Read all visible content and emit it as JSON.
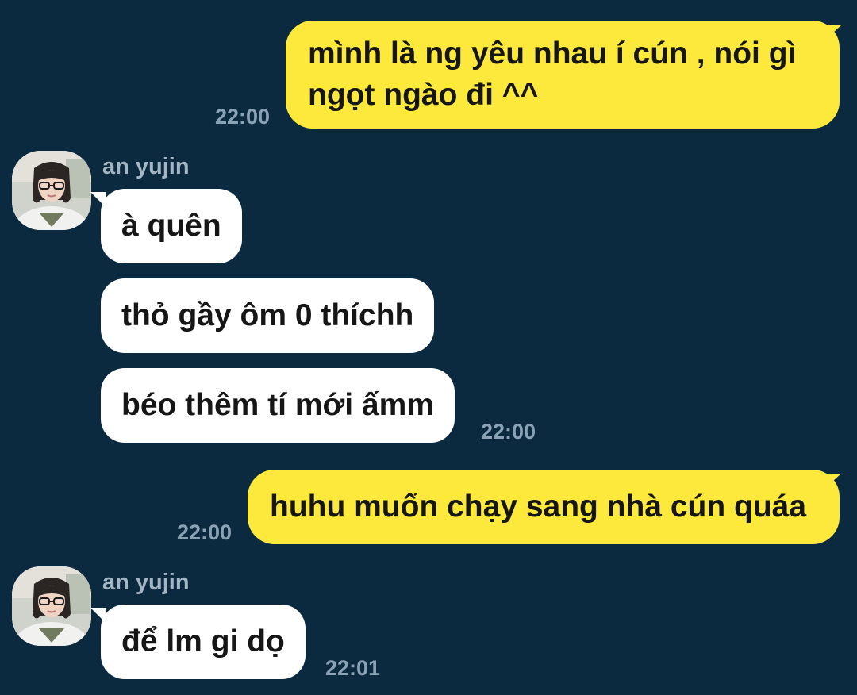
{
  "chat": {
    "messages": [
      {
        "side": "out",
        "text": "mình là ng yêu nhau í cún , nói gì ngọt ngào đi ^^",
        "time": "22:00"
      },
      {
        "side": "in",
        "sender": "an yujin",
        "text": "à quên"
      },
      {
        "side": "in",
        "text": "thỏ gầy ôm 0 thíchh"
      },
      {
        "side": "in",
        "text": "béo thêm tí mới ấmm",
        "time": "22:00"
      },
      {
        "side": "out",
        "text": "huhu muốn chạy sang nhà cún quáa",
        "time": "22:00"
      },
      {
        "side": "in",
        "sender": "an yujin",
        "text": "để lm gi dọ",
        "time": "22:01"
      }
    ]
  },
  "colors": {
    "background": "#0b2a40",
    "outgoing_bubble": "#fde93c",
    "incoming_bubble": "#ffffff",
    "timestamp": "#8ba1b4",
    "sender_name": "#a4b5c4"
  },
  "icons": {
    "avatar": "avatar-an-yujin"
  }
}
